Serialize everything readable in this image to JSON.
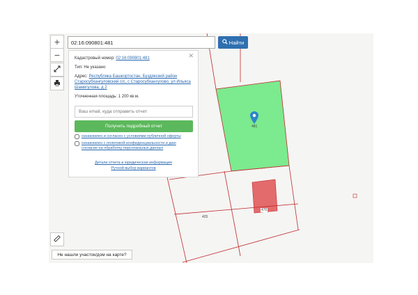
{
  "search": {
    "value": "02:16:090801:481",
    "button_label": "Найти"
  },
  "zoom": {
    "in_label": "+",
    "out_label": "−"
  },
  "popup": {
    "cadastral_label": "Кадастровый номер:",
    "cadastral_value": "02:16:090801:481",
    "type_label": "Тип:",
    "type_value": "Не указано",
    "address_label": "Адрес:",
    "address_value": "Республика Башкортостан, Буздякский район Старосубхангуловский с/с, с Старосубхангулово, ул Ильяса Шамигулова, д 2",
    "area_label": "Уточненная площадь:",
    "area_value": "1 200 кв.м.",
    "email_placeholder": "Ваш email, куда отправить отчет",
    "report_button": "Получить подробный отчет",
    "check1": "ознакомлен и согласен с условиями публичной оферты",
    "check2": "ознакомлен с политикой конфиденциальности и даю согласие на обработку персональных данных",
    "link1": "Детали отчета и юридическая информация",
    "link2": "Ручной выбор вариантов"
  },
  "map_labels": {
    "marker_number": "481",
    "red_parcel_number": "470",
    "parcel_425": "425",
    "top_number": "481"
  },
  "not_found_button": "Не нашли участок/дом на карте?",
  "colors": {
    "selected_parcel": "#7cea8e",
    "other_parcel": "#e46b6b",
    "boundary": "#c0282d",
    "search_button": "#2f6fb0",
    "report_button": "#5cb85c",
    "marker": "#2e86c9"
  }
}
